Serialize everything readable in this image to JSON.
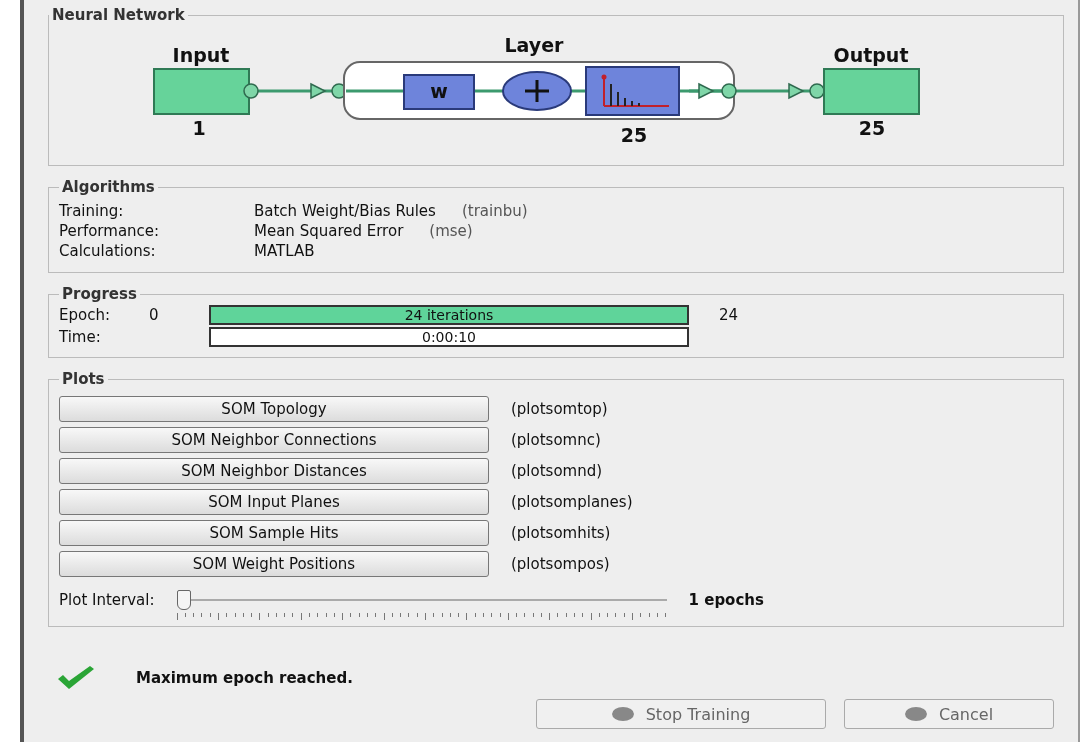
{
  "network": {
    "title": "Neural Network",
    "input": {
      "label": "Input",
      "size": "1"
    },
    "layer": {
      "label": "Layer",
      "weight": "w",
      "size": "25"
    },
    "output": {
      "label": "Output",
      "size": "25"
    }
  },
  "algorithms": {
    "title": "Algorithms",
    "rows": [
      {
        "label": "Training:",
        "value": "Batch Weight/Bias Rules",
        "code": "(trainbu)"
      },
      {
        "label": "Performance:",
        "value": "Mean Squared Error",
        "code": "(mse)"
      },
      {
        "label": "Calculations:",
        "value": "MATLAB"
      }
    ]
  },
  "progress": {
    "title": "Progress",
    "rows": [
      {
        "label": "Epoch:",
        "start": "0",
        "bar_text": "24 iterations",
        "level": 1,
        "end": "24"
      },
      {
        "label": "Time:",
        "bar_text": "0:00:10"
      }
    ]
  },
  "plots": {
    "title": "Plots",
    "buttons": [
      {
        "label": "SOM Topology",
        "code": "(plotsomtop)"
      },
      {
        "label": "SOM Neighbor Connections",
        "code": "(plotsomnc)"
      },
      {
        "label": "SOM Neighbor Distances",
        "code": "(plotsomnd)"
      },
      {
        "label": "SOM Input Planes",
        "code": "(plotsomplanes)"
      },
      {
        "label": "SOM Sample Hits",
        "code": "(plotsomhits)"
      },
      {
        "label": "SOM Weight Positions",
        "code": "(plotsompos)"
      }
    ],
    "interval": {
      "label": "Plot Interval:",
      "level": 0,
      "reading": "1 epochs"
    }
  },
  "status": {
    "message": "Maximum epoch reached."
  },
  "buttons": [
    {
      "label": "Stop Training",
      "disabled": true
    },
    {
      "label": "Cancel",
      "disabled": true
    }
  ]
}
